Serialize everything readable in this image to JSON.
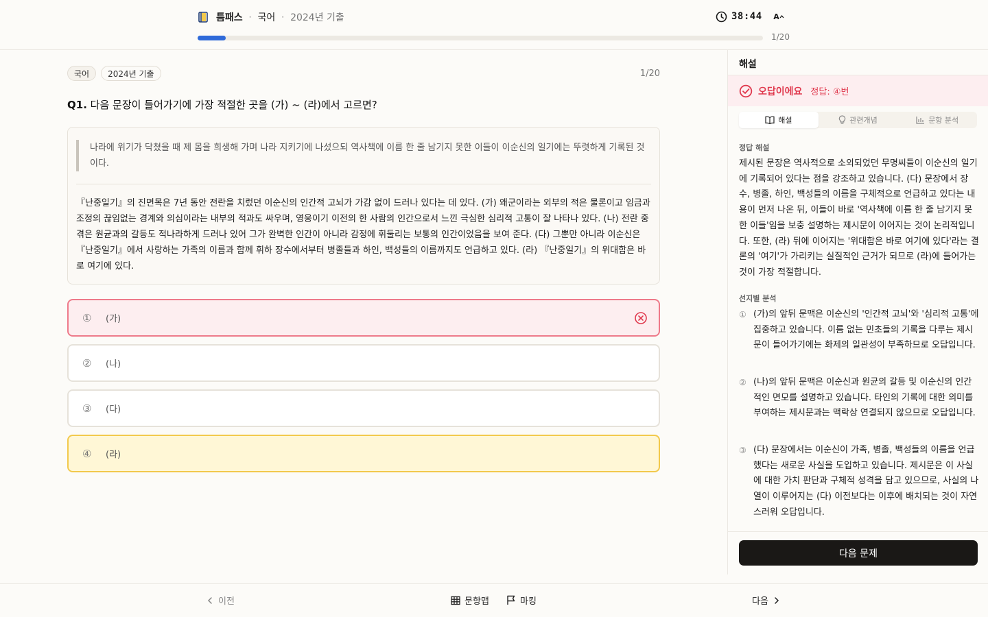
{
  "header": {
    "brand": "틈패스",
    "subject": "국어",
    "exam": "2024년 기출",
    "timer": "38:44",
    "font_toggle": "A",
    "progress_count": "1/20",
    "progress_fraction": 0.05
  },
  "question": {
    "tags": [
      "국어",
      "2024년 기출"
    ],
    "count": "1/20",
    "number": "Q1.",
    "text": "다음 문장이 들어가기에 가장 적절한 곳을 (가) ~ (라)에서 고르면?",
    "insert_sentence": "나라에 위기가 닥쳤을 때 제 몸을 희생해 가며 나라 지키기에 나섰으되 역사책에 이름 한 줄 남기지 못한 이들이 이순신의 일기에는 뚜렷하게 기록된 것이다.",
    "passage": "『난중일기』의 진면목은 7년 동안 전란을 치렀던 이순신의 인간적 고뇌가 가감 없이 드러나 있다는 데 있다. (가) 왜군이라는 외부의 적은 물론이고 임금과 조정의 끊임없는 경계와 의심이라는 내부의 적과도 싸우며, 영웅이기 이전의 한 사람의 인간으로서 느낀 극심한 심리적 고통이 잘 나타나 있다. (나) 전란 중 겪은 원균과의 갈등도 적나라하게 드러나 있어 그가 완벽한 인간이 아니라 감정에 휘둘리는 보통의 인간이었음을 보여 준다. (다) 그뿐만 아니라 이순신은 『난중일기』에서 사랑하는 가족의 이름과 함께 휘하 장수에서부터 병졸들과 하인, 백성들의 이름까지도 언급하고 있다. (라) 『난중일기』의 위대함은 바로 여기에 있다."
  },
  "choices": [
    {
      "num": "①",
      "label": "(가)",
      "state": "wrong"
    },
    {
      "num": "②",
      "label": "(나)",
      "state": "normal"
    },
    {
      "num": "③",
      "label": "(다)",
      "state": "normal"
    },
    {
      "num": "④",
      "label": "(라)",
      "state": "correct"
    }
  ],
  "panel": {
    "title": "해설",
    "verdict": "오답이에요",
    "answer": "정답: ④번",
    "tabs": [
      "해설",
      "관련개념",
      "문항 분석"
    ],
    "explanation_label": "정답 해설",
    "explanation": "제시된 문장은 역사적으로 소외되었던 무명씨들이 이순신의 일기에 기록되어 있다는 점을 강조하고 있습니다. (다) 문장에서 장수, 병졸, 하인, 백성들의 이름을 구체적으로 언급하고 있다는 내용이 먼저 나온 뒤, 이들이 바로 '역사책에 이름 한 줄 남기지 못한 이들'임을 보충 설명하는 제시문이 이어지는 것이 논리적입니다. 또한, (라) 뒤에 이어지는 '위대함은 바로 여기에 있다'라는 결론의 '여기'가 가리키는 실질적인 근거가 되므로 (라)에 들어가는 것이 가장 적절합니다.",
    "analysis_label": "선지별 분석",
    "analysis": [
      {
        "num": "①",
        "text": "(가)의 앞뒤 문맥은 이순신의 '인간적 고뇌'와 '심리적 고통'에 집중하고 있습니다. 이름 없는 민초들의 기록을 다루는 제시문이 들어가기에는 화제의 일관성이 부족하므로 오답입니다."
      },
      {
        "num": "②",
        "text": "(나)의 앞뒤 문맥은 이순신과 원균의 갈등 및 이순신의 인간적인 면모를 설명하고 있습니다. 타인의 기록에 대한 의미를 부여하는 제시문과는 맥락상 연결되지 않으므로 오답입니다."
      },
      {
        "num": "③",
        "text": "(다) 문장에서는 이순신이 가족, 병졸, 백성들의 이름을 언급했다는 새로운 사실을 도입하고 있습니다. 제시문은 이 사실에 대한 가치 판단과 구체적 성격을 담고 있으므로, 사실의 나열이 이루어지는 (다) 이전보다는 이후에 배치되는 것이 자연스러워 오답입니다."
      }
    ],
    "next_button": "다음 문제"
  },
  "bottom": {
    "prev": "이전",
    "map": "문항맵",
    "mark": "마킹",
    "next": "다음"
  },
  "colors": {
    "accent": "#2f6ad9",
    "wrong": "#e0394e",
    "correct": "#f2c94c",
    "dark": "#1a1816"
  }
}
